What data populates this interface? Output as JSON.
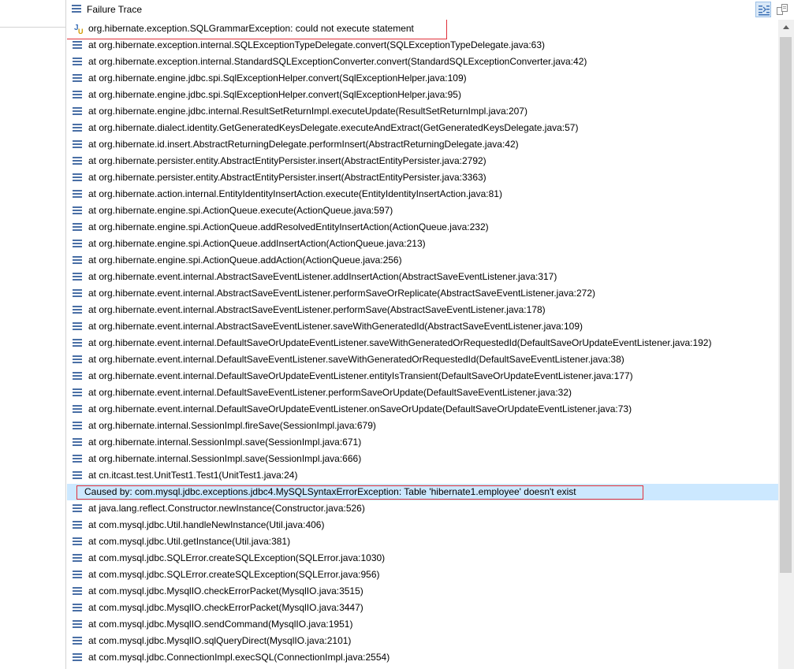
{
  "header": {
    "title": "Failure Trace",
    "icon": "stack-trace-icon",
    "toolbar": {
      "filter_icon": "filter-stack-trace-icon",
      "compare_icon": "compare-result-icon"
    }
  },
  "exception_line": "org.hibernate.exception.SQLGrammarException: could not execute statement",
  "frames": [
    "at org.hibernate.exception.internal.SQLExceptionTypeDelegate.convert(SQLExceptionTypeDelegate.java:63)",
    "at org.hibernate.exception.internal.StandardSQLExceptionConverter.convert(StandardSQLExceptionConverter.java:42)",
    "at org.hibernate.engine.jdbc.spi.SqlExceptionHelper.convert(SqlExceptionHelper.java:109)",
    "at org.hibernate.engine.jdbc.spi.SqlExceptionHelper.convert(SqlExceptionHelper.java:95)",
    "at org.hibernate.engine.jdbc.internal.ResultSetReturnImpl.executeUpdate(ResultSetReturnImpl.java:207)",
    "at org.hibernate.dialect.identity.GetGeneratedKeysDelegate.executeAndExtract(GetGeneratedKeysDelegate.java:57)",
    "at org.hibernate.id.insert.AbstractReturningDelegate.performInsert(AbstractReturningDelegate.java:42)",
    "at org.hibernate.persister.entity.AbstractEntityPersister.insert(AbstractEntityPersister.java:2792)",
    "at org.hibernate.persister.entity.AbstractEntityPersister.insert(AbstractEntityPersister.java:3363)",
    "at org.hibernate.action.internal.EntityIdentityInsertAction.execute(EntityIdentityInsertAction.java:81)",
    "at org.hibernate.engine.spi.ActionQueue.execute(ActionQueue.java:597)",
    "at org.hibernate.engine.spi.ActionQueue.addResolvedEntityInsertAction(ActionQueue.java:232)",
    "at org.hibernate.engine.spi.ActionQueue.addInsertAction(ActionQueue.java:213)",
    "at org.hibernate.engine.spi.ActionQueue.addAction(ActionQueue.java:256)",
    "at org.hibernate.event.internal.AbstractSaveEventListener.addInsertAction(AbstractSaveEventListener.java:317)",
    "at org.hibernate.event.internal.AbstractSaveEventListener.performSaveOrReplicate(AbstractSaveEventListener.java:272)",
    "at org.hibernate.event.internal.AbstractSaveEventListener.performSave(AbstractSaveEventListener.java:178)",
    "at org.hibernate.event.internal.AbstractSaveEventListener.saveWithGeneratedId(AbstractSaveEventListener.java:109)",
    "at org.hibernate.event.internal.DefaultSaveOrUpdateEventListener.saveWithGeneratedOrRequestedId(DefaultSaveOrUpdateEventListener.java:192)",
    "at org.hibernate.event.internal.DefaultSaveEventListener.saveWithGeneratedOrRequestedId(DefaultSaveEventListener.java:38)",
    "at org.hibernate.event.internal.DefaultSaveOrUpdateEventListener.entityIsTransient(DefaultSaveOrUpdateEventListener.java:177)",
    "at org.hibernate.event.internal.DefaultSaveEventListener.performSaveOrUpdate(DefaultSaveEventListener.java:32)",
    "at org.hibernate.event.internal.DefaultSaveOrUpdateEventListener.onSaveOrUpdate(DefaultSaveOrUpdateEventListener.java:73)",
    "at org.hibernate.internal.SessionImpl.fireSave(SessionImpl.java:679)",
    "at org.hibernate.internal.SessionImpl.save(SessionImpl.java:671)",
    "at org.hibernate.internal.SessionImpl.save(SessionImpl.java:666)",
    "at cn.itcast.test.UnitTest1.Test1(UnitTest1.java:24)"
  ],
  "caused_by_line": "Caused by: com.mysql.jdbc.exceptions.jdbc4.MySQLSyntaxErrorException: Table 'hibernate1.employee' doesn't exist",
  "cause_frames": [
    "at java.lang.reflect.Constructor.newInstance(Constructor.java:526)",
    "at com.mysql.jdbc.Util.handleNewInstance(Util.java:406)",
    "at com.mysql.jdbc.Util.getInstance(Util.java:381)",
    "at com.mysql.jdbc.SQLError.createSQLException(SQLError.java:1030)",
    "at com.mysql.jdbc.SQLError.createSQLException(SQLError.java:956)",
    "at com.mysql.jdbc.MysqlIO.checkErrorPacket(MysqlIO.java:3515)",
    "at com.mysql.jdbc.MysqlIO.checkErrorPacket(MysqlIO.java:3447)",
    "at com.mysql.jdbc.MysqlIO.sendCommand(MysqlIO.java:1951)",
    "at com.mysql.jdbc.MysqlIO.sqlQueryDirect(MysqlIO.java:2101)",
    "at com.mysql.jdbc.ConnectionImpl.execSQL(ConnectionImpl.java:2554)"
  ],
  "colors": {
    "selection": "#cce8ff",
    "highlight_box": "#e0303a",
    "frame_icon": "#4a6fa5"
  }
}
